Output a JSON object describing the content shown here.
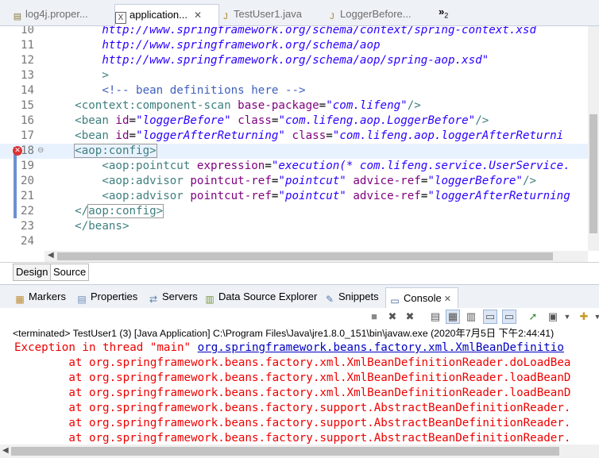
{
  "editor_tabs": [
    {
      "label": "log4j.proper...",
      "icon": "properties-file-icon",
      "active": false
    },
    {
      "label": "application...",
      "icon": "xml-file-icon",
      "active": true
    },
    {
      "label": "TestUser1.java",
      "icon": "java-file-icon",
      "active": false
    },
    {
      "label": "LoggerBefore...",
      "icon": "java-file-icon",
      "active": false
    }
  ],
  "tab_overflow": {
    "symbol": "»",
    "count": "2"
  },
  "code_lines": [
    {
      "n": "10",
      "parts": [
        {
          "c": "val",
          "t": "        http://www.springframework.org/schema/context/spring-context.xsd"
        }
      ]
    },
    {
      "n": "11",
      "parts": [
        {
          "c": "val",
          "t": "        http://www.springframework.org/schema/aop"
        }
      ]
    },
    {
      "n": "12",
      "parts": [
        {
          "c": "val",
          "t": "        http://www.springframework.org/schema/aop/spring-aop.xsd\""
        }
      ]
    },
    {
      "n": "13",
      "parts": [
        {
          "c": "tag",
          "t": "        >"
        }
      ]
    },
    {
      "n": "14",
      "parts": [
        {
          "c": "com",
          "t": "        <!-- bean definitions here -->"
        }
      ]
    },
    {
      "n": "15",
      "parts": [
        {
          "c": "tag",
          "t": "    <context:component-scan "
        },
        {
          "c": "attr",
          "t": "base-package"
        },
        {
          "c": "pl",
          "t": "="
        },
        {
          "c": "val",
          "t": "\"com.lifeng\""
        },
        {
          "c": "tag",
          "t": "/>"
        }
      ]
    },
    {
      "n": "16",
      "parts": [
        {
          "c": "tag",
          "t": "    <bean "
        },
        {
          "c": "attr",
          "t": "id"
        },
        {
          "c": "pl",
          "t": "="
        },
        {
          "c": "val",
          "t": "\"loggerBefore\""
        },
        {
          "c": "pl",
          "t": " "
        },
        {
          "c": "attr",
          "t": "class"
        },
        {
          "c": "pl",
          "t": "="
        },
        {
          "c": "val",
          "t": "\"com.lifeng.aop.LoggerBefore\""
        },
        {
          "c": "tag",
          "t": "/>"
        }
      ]
    },
    {
      "n": "17",
      "parts": [
        {
          "c": "tag",
          "t": "    <bean "
        },
        {
          "c": "attr",
          "t": "id"
        },
        {
          "c": "pl",
          "t": "="
        },
        {
          "c": "val",
          "t": "\"loggerAfterReturning\""
        },
        {
          "c": "pl",
          "t": " "
        },
        {
          "c": "attr",
          "t": "class"
        },
        {
          "c": "pl",
          "t": "="
        },
        {
          "c": "val",
          "t": "\"com.lifeng.aop.loggerAfterReturni"
        }
      ]
    },
    {
      "n": "18",
      "hl": true,
      "parts": [
        {
          "c": "tag",
          "t": "    "
        },
        {
          "c": "tag bx",
          "t": "<aop:config>"
        }
      ]
    },
    {
      "n": "19",
      "parts": [
        {
          "c": "tag",
          "t": "        <aop:pointcut "
        },
        {
          "c": "attr",
          "t": "expression"
        },
        {
          "c": "pl",
          "t": "="
        },
        {
          "c": "val",
          "t": "\"execution(* com.lifeng.service.UserService."
        }
      ]
    },
    {
      "n": "20",
      "parts": [
        {
          "c": "tag",
          "t": "        <aop:advisor "
        },
        {
          "c": "attr",
          "t": "pointcut-ref"
        },
        {
          "c": "pl",
          "t": "="
        },
        {
          "c": "val",
          "t": "\"pointcut\""
        },
        {
          "c": "pl",
          "t": " "
        },
        {
          "c": "attr",
          "t": "advice-ref"
        },
        {
          "c": "pl",
          "t": "="
        },
        {
          "c": "val",
          "t": "\"loggerBefore\""
        },
        {
          "c": "tag",
          "t": "/>"
        }
      ]
    },
    {
      "n": "21",
      "parts": [
        {
          "c": "tag",
          "t": "        <aop:advisor "
        },
        {
          "c": "attr",
          "t": "pointcut-ref"
        },
        {
          "c": "pl",
          "t": "="
        },
        {
          "c": "val",
          "t": "\"pointcut\""
        },
        {
          "c": "pl",
          "t": " "
        },
        {
          "c": "attr",
          "t": "advice-ref"
        },
        {
          "c": "pl",
          "t": "="
        },
        {
          "c": "val",
          "t": "\"loggerAfterReturning"
        }
      ]
    },
    {
      "n": "22",
      "parts": [
        {
          "c": "tag",
          "t": "    </"
        },
        {
          "c": "tag bx",
          "t": "aop:config>"
        }
      ]
    },
    {
      "n": "23",
      "parts": [
        {
          "c": "tag",
          "t": "    </beans>"
        }
      ]
    },
    {
      "n": "24",
      "parts": []
    }
  ],
  "bottom_tabs": {
    "design": "Design",
    "source": "Source"
  },
  "views": [
    {
      "label": "Markers",
      "icon": "markers-icon",
      "color": "#c08a2c"
    },
    {
      "label": "Properties",
      "icon": "properties-icon",
      "color": "#6e8cb8"
    },
    {
      "label": "Servers",
      "icon": "servers-icon",
      "color": "#5a7fa8"
    },
    {
      "label": "Data Source Explorer",
      "icon": "data-source-icon",
      "color": "#7a9a3a"
    },
    {
      "label": "Snippets",
      "icon": "snippets-icon",
      "color": "#5577aa"
    },
    {
      "label": "Console",
      "icon": "console-icon",
      "color": "#3a5f8f"
    }
  ],
  "console_label": "<terminated> TestUser1 (3) [Java Application] C:\\Program Files\\Java\\jre1.8.0_151\\bin\\javaw.exe (2020年7月5日 下午2:44:41)",
  "console_lines": [
    {
      "prefix": "Exception in thread \"main\" ",
      "link": "org.springframework.beans.factory.xml.XmlBeanDefinitio"
    },
    {
      "prefix": "        at org.springframework.beans.factory.xml.XmlBeanDefinitionReader.doLoadBea",
      "link": ""
    },
    {
      "prefix": "        at org.springframework.beans.factory.xml.XmlBeanDefinitionReader.loadBeanD",
      "link": ""
    },
    {
      "prefix": "        at org.springframework.beans.factory.xml.XmlBeanDefinitionReader.loadBeanD",
      "link": ""
    },
    {
      "prefix": "        at org.springframework.beans.factory.support.AbstractBeanDefinitionReader.",
      "link": ""
    },
    {
      "prefix": "        at org.springframework.beans.factory.support.AbstractBeanDefinitionReader.",
      "link": ""
    },
    {
      "prefix": "        at org.springframework.beans.factory.support.AbstractBeanDefinitionReader.",
      "link": ""
    }
  ],
  "colors": {
    "error": "#e00000",
    "link": "#0000c0",
    "tag": "#3f7f7f",
    "attribute": "#7f007f",
    "value": "#2a00ff",
    "comment": "#3f5fbf"
  }
}
